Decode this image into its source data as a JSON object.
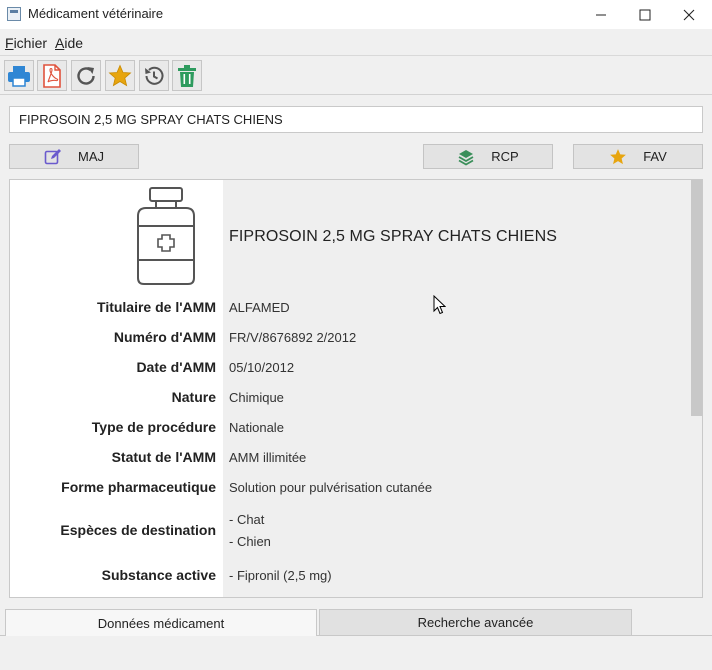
{
  "window": {
    "title": "Médicament vétérinaire",
    "controls": {
      "minimize": "—",
      "maximize": "☐",
      "close": "✕"
    }
  },
  "menubar": {
    "items": [
      {
        "label": "Fichier",
        "mnemonic": "F",
        "rest": "ichier"
      },
      {
        "label": "Aide",
        "mnemonic": "A",
        "rest": "ide"
      }
    ]
  },
  "toolbar": {
    "buttons": [
      {
        "name": "print-icon",
        "color": "#2f86d4"
      },
      {
        "name": "pdf-icon",
        "color": "#e0533d"
      },
      {
        "name": "refresh-icon",
        "color": "#555555"
      },
      {
        "name": "star-icon",
        "color": "#e7a50f"
      },
      {
        "name": "history-icon",
        "color": "#555555"
      },
      {
        "name": "trash-icon",
        "color": "#2e9b5e"
      }
    ]
  },
  "search": {
    "value": "FIPROSOIN 2,5 MG SPRAY CHATS CHIENS",
    "placeholder": ""
  },
  "actions": {
    "maj": "MAJ",
    "rcp": "RCP",
    "fav": "FAV"
  },
  "drug": {
    "name": "FIPROSOIN 2,5 MG SPRAY CHATS CHIENS",
    "fields": [
      {
        "label": "Titulaire de l'AMM",
        "value": "ALFAMED"
      },
      {
        "label": "Numéro d'AMM",
        "value": "FR/V/8676892 2/2012"
      },
      {
        "label": "Date d'AMM",
        "value": "05/10/2012"
      },
      {
        "label": "Nature",
        "value": "Chimique"
      },
      {
        "label": "Type de procédure",
        "value": "Nationale"
      },
      {
        "label": "Statut de l'AMM",
        "value": "AMM illimitée"
      },
      {
        "label": "Forme pharmaceutique",
        "value": "Solution pour pulvérisation cutanée"
      },
      {
        "label": "Espèces de destination",
        "values": [
          "- Chat",
          "- Chien"
        ]
      },
      {
        "label": "Substance active",
        "value": "- Fipronil (2,5 mg)"
      }
    ]
  },
  "tabs": {
    "active": "Données médicament",
    "inactive": "Recherche avancée"
  },
  "colors": {
    "accent_blue": "#2f86d4",
    "pdf_red": "#e0533d",
    "star_yellow": "#e7a50f",
    "trash_green": "#2e9b5e",
    "rcp_green": "#3a8f5a",
    "maj_purple": "#6a5acd"
  }
}
